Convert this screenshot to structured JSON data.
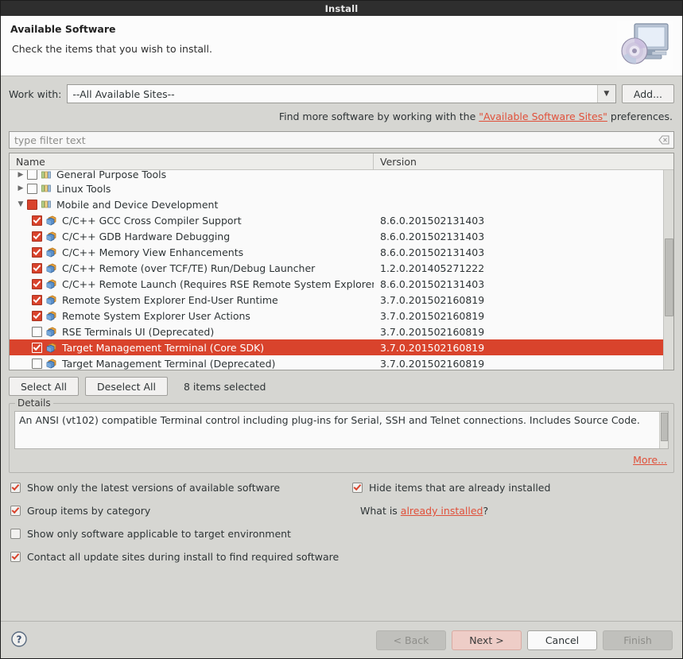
{
  "window": {
    "title": "Install"
  },
  "header": {
    "title": "Available Software",
    "subtitle": "Check the items that you wish to install.",
    "icon": "install-disc-computer-icon"
  },
  "work_with": {
    "label": "Work with:",
    "value": "--All Available Sites--",
    "dropdown_icon": "chevron-down-icon",
    "add_button": "Add...",
    "hint_prefix": "Find more software by working with the ",
    "hint_link": "\"Available Software Sites\"",
    "hint_suffix": " preferences."
  },
  "filter": {
    "placeholder": "type filter text",
    "value": "",
    "clear_icon": "clear-filter-icon"
  },
  "tree": {
    "columns": {
      "name": "Name",
      "version": "Version"
    },
    "rows": [
      {
        "name": "General Purpose Tools",
        "version": "",
        "type": "category",
        "twisty": "collapsed",
        "checked": "none",
        "clipped": true,
        "selected": false
      },
      {
        "name": "Linux Tools",
        "version": "",
        "type": "category",
        "twisty": "collapsed",
        "checked": "none",
        "clipped": false,
        "selected": false
      },
      {
        "name": "Mobile and Device Development",
        "version": "",
        "type": "category",
        "twisty": "expanded",
        "checked": "partial",
        "clipped": false,
        "selected": false
      },
      {
        "name": "C/C++ GCC Cross Compiler Support",
        "version": "8.6.0.201502131403",
        "type": "feature",
        "twisty": "none",
        "checked": "checked",
        "clipped": false,
        "selected": false
      },
      {
        "name": "C/C++ GDB Hardware Debugging",
        "version": "8.6.0.201502131403",
        "type": "feature",
        "twisty": "none",
        "checked": "checked",
        "clipped": false,
        "selected": false
      },
      {
        "name": "C/C++ Memory View Enhancements",
        "version": "8.6.0.201502131403",
        "type": "feature",
        "twisty": "none",
        "checked": "checked",
        "clipped": false,
        "selected": false
      },
      {
        "name": "C/C++ Remote (over TCF/TE) Run/Debug Launcher",
        "version": "1.2.0.201405271222",
        "type": "feature",
        "twisty": "none",
        "checked": "checked",
        "clipped": false,
        "selected": false
      },
      {
        "name": "C/C++ Remote Launch (Requires RSE Remote System Explorer",
        "version": "8.6.0.201502131403",
        "type": "feature",
        "twisty": "none",
        "checked": "checked",
        "clipped": false,
        "selected": false
      },
      {
        "name": "Remote System Explorer End-User Runtime",
        "version": "3.7.0.201502160819",
        "type": "feature",
        "twisty": "none",
        "checked": "checked",
        "clipped": false,
        "selected": false
      },
      {
        "name": "Remote System Explorer User Actions",
        "version": "3.7.0.201502160819",
        "type": "feature",
        "twisty": "none",
        "checked": "checked",
        "clipped": false,
        "selected": false
      },
      {
        "name": "RSE Terminals UI (Deprecated)",
        "version": "3.7.0.201502160819",
        "type": "feature",
        "twisty": "none",
        "checked": "unchecked",
        "clipped": false,
        "selected": false
      },
      {
        "name": "Target Management Terminal (Core SDK)",
        "version": "3.7.0.201502160819",
        "type": "feature",
        "twisty": "none",
        "checked": "checked",
        "clipped": false,
        "selected": true
      },
      {
        "name": "Target Management Terminal (Deprecated)",
        "version": "3.7.0.201502160819",
        "type": "feature",
        "twisty": "none",
        "checked": "unchecked",
        "clipped": false,
        "selected": false
      }
    ]
  },
  "selection_bar": {
    "select_all": "Select All",
    "deselect_all": "Deselect All",
    "count_text": "8 items selected"
  },
  "details": {
    "legend": "Details",
    "text": "An ANSI (vt102) compatible Terminal control including plug-ins for Serial, SSH and Telnet connections. Includes Source Code.",
    "more_link": "More..."
  },
  "options": {
    "left": [
      {
        "label": "Show only the latest versions of available software",
        "checked": true
      },
      {
        "label": "Group items by category",
        "checked": true
      },
      {
        "label": "Show only software applicable to target environment",
        "checked": false
      },
      {
        "label": "Contact all update sites during install to find required software",
        "checked": true
      }
    ],
    "right": [
      {
        "label": "Hide items that are already installed",
        "checked": true
      }
    ],
    "whatis_prefix": "What is ",
    "whatis_link": "already installed",
    "whatis_suffix": "?"
  },
  "footer": {
    "help_icon": "help-question-icon",
    "back": "< Back",
    "next": "Next >",
    "cancel": "Cancel",
    "finish": "Finish"
  },
  "colors": {
    "selection_red": "#d9432c",
    "link_red": "#e0503a",
    "titlebar": "#2e2e2e",
    "dialog_bg": "#d6d6d2"
  }
}
